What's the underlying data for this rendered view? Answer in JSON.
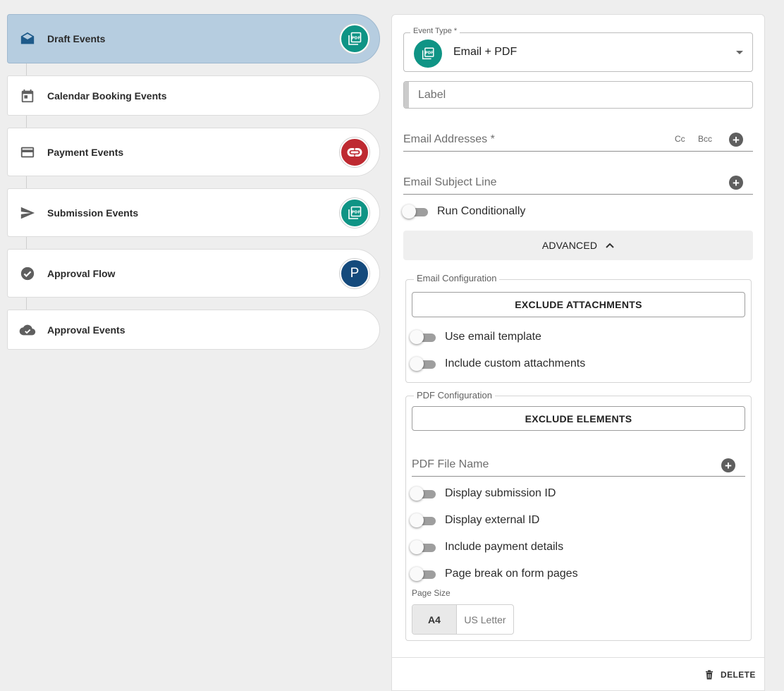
{
  "events": [
    {
      "label": "Draft Events",
      "icon": "envelope-open-icon",
      "badge": "pdf",
      "active": true
    },
    {
      "label": "Calendar Booking Events",
      "icon": "calendar-icon",
      "badge": null
    },
    {
      "label": "Payment Events",
      "icon": "credit-card-icon",
      "badge": "payment"
    },
    {
      "label": "Submission Events",
      "icon": "send-icon",
      "badge": "pdf"
    },
    {
      "label": "Approval Flow",
      "icon": "check-circle-icon",
      "badge": "P"
    },
    {
      "label": "Approval Events",
      "icon": "cloud-check-icon",
      "badge": null
    }
  ],
  "badges": {
    "pdf_text": "PDF",
    "approval_letter": "P"
  },
  "colors": {
    "active": "#b6cde0",
    "teal": "#0f9485",
    "red": "#be2a31",
    "blue": "#144a7c"
  },
  "panel": {
    "event_type": {
      "legend": "Event Type *",
      "value": "Email + PDF"
    },
    "label_placeholder": "Label",
    "email_addresses": {
      "label": "Email Addresses *",
      "cc": "Cc",
      "bcc": "Bcc"
    },
    "email_subject": {
      "label": "Email Subject Line"
    },
    "run_conditionally": "Run Conditionally",
    "advanced": "ADVANCED",
    "email_config": {
      "legend": "Email Configuration",
      "exclude_button": "EXCLUDE ATTACHMENTS",
      "toggles": [
        "Use email template",
        "Include custom attachments"
      ]
    },
    "pdf_config": {
      "legend": "PDF Configuration",
      "exclude_button": "EXCLUDE ELEMENTS",
      "file_name_label": "PDF File Name",
      "toggles": [
        "Display submission ID",
        "Display external ID",
        "Include payment details",
        "Page break on form pages"
      ],
      "page_size_label": "Page Size",
      "page_sizes": [
        "A4",
        "US Letter"
      ],
      "selected_page_size": "A4"
    },
    "delete": "DELETE"
  }
}
